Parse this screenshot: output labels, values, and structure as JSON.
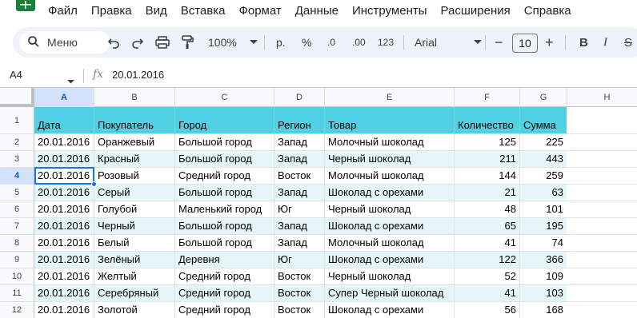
{
  "menu": {
    "app_icon": "sheets-logo-icon",
    "items": [
      "Файл",
      "Правка",
      "Вид",
      "Вставка",
      "Формат",
      "Данные",
      "Инструменты",
      "Расширения",
      "Справка"
    ]
  },
  "toolbar": {
    "search_label": "Меню",
    "zoom": "100%",
    "currency": "р.",
    "percent": "%",
    "decrease_decimals": ".0",
    "increase_decimals": ".00",
    "number_format": "123",
    "font": "Arial",
    "font_size": "10",
    "minus": "−",
    "plus": "+",
    "bold": "B",
    "italic": "I"
  },
  "formula_bar": {
    "cell_ref": "A4",
    "fx": "fx",
    "value": "20.01.2016"
  },
  "columns": [
    "A",
    "B",
    "C",
    "D",
    "E",
    "F",
    "G",
    "H"
  ],
  "selected_column": "A",
  "selected_row": "4",
  "row_numbers": [
    "1",
    "2",
    "3",
    "4",
    "5",
    "6",
    "7",
    "8",
    "9",
    "10",
    "11",
    "12"
  ],
  "table": {
    "headers": [
      "Дата",
      "Покупатель",
      "Город",
      "Регион",
      "Товар",
      "Количество",
      "Сумма"
    ],
    "rows": [
      [
        "20.01.2016",
        "Оранжевый",
        "Большой город",
        "Запад",
        "Молочный шоколад",
        "125",
        "225"
      ],
      [
        "20.01.2016",
        "Красный",
        "Большой город",
        "Запад",
        "Черный шоколад",
        "211",
        "443"
      ],
      [
        "20.01.2016",
        "Розовый",
        "Средний город",
        "Восток",
        "Молочный шоколад",
        "144",
        "259"
      ],
      [
        "20.01.2016",
        "Серый",
        "Большой город",
        "Запад",
        "Шоколад с орехами",
        "21",
        "63"
      ],
      [
        "20.01.2016",
        "Голубой",
        "Маленький город",
        "Юг",
        "Черный шоколад",
        "48",
        "101"
      ],
      [
        "20.01.2016",
        "Черный",
        "Большой город",
        "Запад",
        "Шоколад с орехами",
        "65",
        "195"
      ],
      [
        "20.01.2016",
        "Белый",
        "Большой город",
        "Запад",
        "Молочный шоколад",
        "41",
        "74"
      ],
      [
        "20.01.2016",
        "Зелёный",
        "Деревня",
        "Юг",
        "Шоколад с орехами",
        "122",
        "366"
      ],
      [
        "20.01.2016",
        "Желтый",
        "Средний город",
        "Восток",
        "Черный шоколад",
        "52",
        "109"
      ],
      [
        "20.01.2016",
        "Серебряный",
        "Средний город",
        "Восток",
        "Супер Черный шоколад",
        "41",
        "103"
      ],
      [
        "20.01.2016",
        "Золотой",
        "Средний город",
        "Восток",
        "Шоколад с орехами",
        "56",
        "168"
      ]
    ]
  },
  "colors": {
    "header_fill": "#4fd0e3",
    "band_fill": "#e4f6f8",
    "selection": "#1a73e8",
    "toolbar_bg": "#eef2f9"
  }
}
